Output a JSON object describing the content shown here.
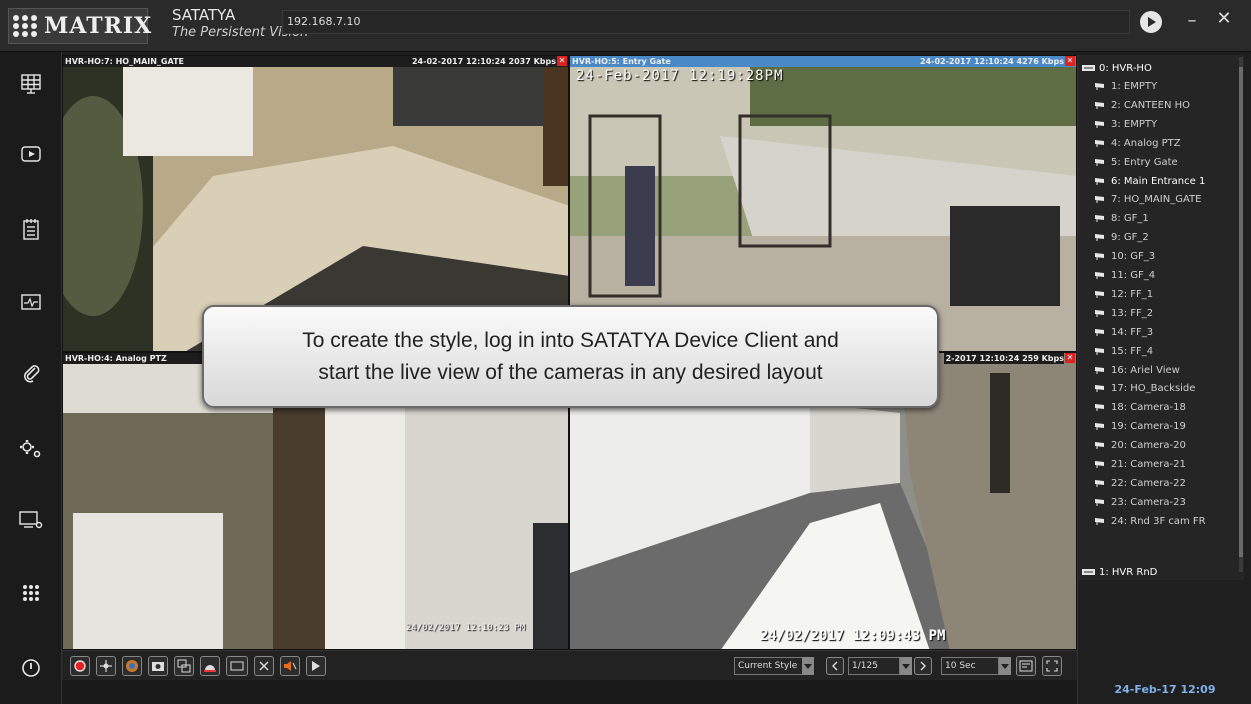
{
  "app": {
    "logo_text": "MATRIX",
    "name": "SATATYA",
    "tagline": "The Persistent Vision",
    "address": "192.168.7.10"
  },
  "window": {
    "minimize": "–",
    "close": "✕"
  },
  "tiles": [
    {
      "camera": "HVR-HO:7: HO_MAIN_GATE",
      "stats": "24-02-2017 12:10:24 2037 Kbps",
      "active": false
    },
    {
      "camera": "HVR-HO:5: Entry Gate",
      "stats": "24-02-2017 12:10:24 4276 Kbps",
      "active": true,
      "osd": "24-Feb-2017  12:19:28PM"
    },
    {
      "camera": "HVR-HO:4: Analog PTZ",
      "stats": "",
      "active": false,
      "osd": "24/02/2017 12:10:23 PM"
    },
    {
      "camera": "",
      "stats": "2-2017 12:10:24  259 Kbps",
      "active": false,
      "osd": "24/02/2017 12:09:43 PM"
    }
  ],
  "callout": {
    "line1": "To create the style, log in into SATATYA Device Client and",
    "line2": "start the live view of the cameras in any desired layout"
  },
  "toolbar": {
    "style": "Current Style",
    "page": "1/125",
    "interval": "10 Sec"
  },
  "tree": {
    "root": "0: HVR-HO",
    "cameras": [
      "1: EMPTY",
      "2: CANTEEN HO",
      "3: EMPTY",
      "4: Analog PTZ",
      "5: Entry Gate",
      "6: Main Entrance 1",
      "7: HO_MAIN_GATE",
      "8: GF_1",
      "9: GF_2",
      "10: GF_3",
      "11: GF_4",
      "12: FF_1",
      "13: FF_2",
      "14: FF_3",
      "15: FF_4",
      "16: Ariel View",
      "17: HO_Backside",
      "18: Camera-18",
      "19: Camera-19",
      "20: Camera-20",
      "21: Camera-21",
      "22: Camera-22",
      "23: Camera-23",
      "24: Rnd 3F cam FR"
    ],
    "second_root": "1: HVR RnD"
  },
  "clock": "24-Feb-17 12:09",
  "colors": {
    "active_tile": "#4a89c8",
    "close_red": "#d22222",
    "clock": "#7fb0e8"
  },
  "icons": [
    "layout-grid-icon",
    "playback-icon",
    "event-log-icon",
    "health-monitor-icon",
    "attachment-icon",
    "settings-icon",
    "device-icon",
    "more-apps-icon",
    "power-icon"
  ]
}
